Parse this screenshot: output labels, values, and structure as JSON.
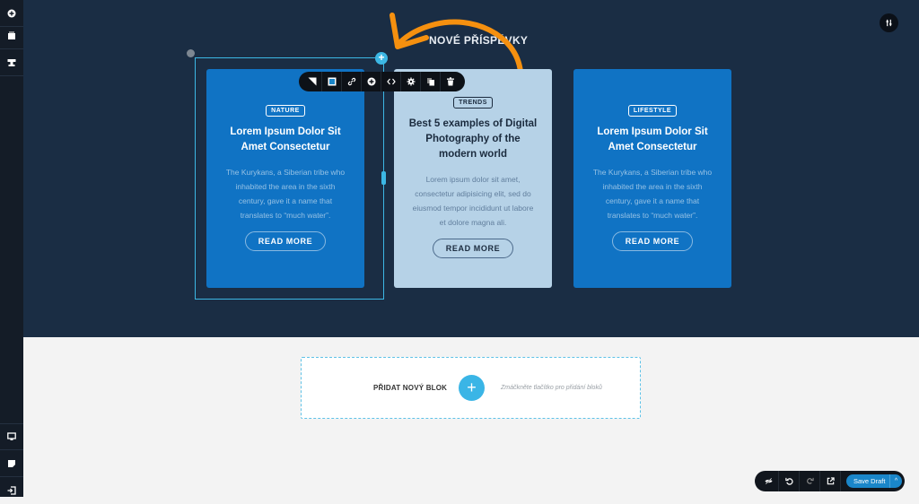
{
  "sidebar": {
    "top_items": [
      {
        "icon": "add-circle-icon",
        "label": "Add"
      },
      {
        "icon": "layers-icon",
        "label": "Blocks"
      },
      {
        "icon": "template-icon",
        "label": "Templates"
      }
    ],
    "bottom_items": [
      {
        "icon": "monitor-icon",
        "label": "Preview"
      },
      {
        "icon": "page-icon",
        "label": "Pages"
      },
      {
        "icon": "exit-icon",
        "label": "Exit"
      }
    ]
  },
  "section": {
    "title": "NOVÉ PŘÍSPĚVKY"
  },
  "block_toolbar": {
    "items": [
      "background-icon",
      "color-icon",
      "link-icon",
      "add-icon",
      "code-icon",
      "settings-icon",
      "duplicate-icon",
      "delete-icon"
    ]
  },
  "cards": [
    {
      "badge": "NATURE",
      "title": "Lorem Ipsum Dolor Sit Amet Consectetur",
      "text": "The Kurykans, a Siberian tribe who inhabited the area in the sixth century, gave it a name that translates to “much water”.",
      "button": "READ MORE"
    },
    {
      "badge": "TRENDS",
      "title": "Best 5 examples of Digital Photography of the modern world",
      "text": "Lorem ipsum dolor sit amet, consectetur adipisicing elit, sed do eiusmod tempor incididunt ut labore et dolore magna ali.",
      "button": "READ MORE"
    },
    {
      "badge": "LIFESTYLE",
      "title": "Lorem Ipsum Dolor Sit Amet Consectetur",
      "text": "The Kurykans, a Siberian tribe who inhabited the area in the sixth century, gave it a name that translates to “much water”.",
      "button": "READ MORE"
    }
  ],
  "add_block": {
    "label": "PŘIDAT NOVÝ BLOK",
    "plus": "+",
    "hint": "Zmáčkněte tlačítko pro přidání bloků"
  },
  "bottom_bar": {
    "items": [
      "hide-icon",
      "undo-icon",
      "redo-icon",
      "external-link-icon"
    ],
    "save_label": "Save Draft",
    "caret": "^"
  },
  "colors": {
    "canvas_bg": "#1a2d44",
    "card_blue": "#1073c4",
    "card_light": "#b6d2e7",
    "accent": "#3cb7e4",
    "arrow": "#f5900f",
    "save": "#1a86c9"
  }
}
